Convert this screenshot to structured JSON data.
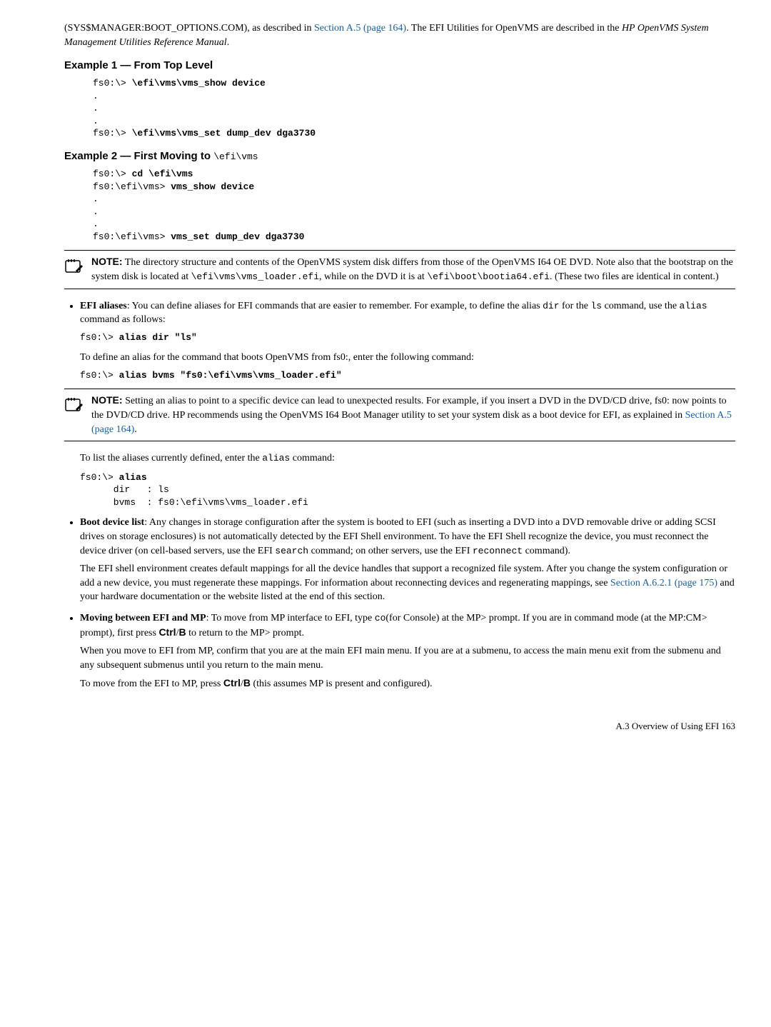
{
  "intro": {
    "text1": "(SYS$MANAGER:BOOT_OPTIONS.COM), as described in ",
    "link": "Section A.5 (page 164)",
    "text2": ". The EFI Utilities for OpenVMS are described in the ",
    "italic": "HP OpenVMS System Management Utilities Reference Manual",
    "text3": "."
  },
  "example1": {
    "heading": "Example 1 — From Top Level",
    "code": "fs0:\\> \\efi\\vms\\vms_show device\n.\n.\n.\nfs0:\\> \\efi\\vms\\vms_set dump_dev dga3730",
    "code_plain_lines": [
      "fs0:\\> ",
      ".",
      ".",
      ".",
      "fs0:\\> "
    ],
    "code_bold_parts": [
      "\\efi\\vms\\vms_show device",
      "\\efi\\vms\\vms_set dump_dev dga3730"
    ]
  },
  "example2": {
    "heading_prefix": "Example 2 — First Moving to ",
    "heading_code": "\\efi\\vms",
    "line1_plain": "fs0:\\> ",
    "line1_bold": "cd \\efi\\vms",
    "line2_plain": "fs0:\\efi\\vms> ",
    "line2_bold": "vms_show device",
    "dots": ".",
    "line3_plain": "fs0:\\efi\\vms> ",
    "line3_bold": "vms_set dump_dev dga3730"
  },
  "note1": {
    "label": "NOTE:",
    "t1": "    The directory structure and contents of the OpenVMS system disk differs from those of the OpenVMS I64 OE DVD. Note also that the bootstrap on the system disk is located at ",
    "c1": "\\efi\\vms\\vms_loader.efi",
    "t2": ", while on the DVD it is at ",
    "c2": "\\efi\\boot\\bootia64.efi",
    "t3": ". (These two files are identical in content.)"
  },
  "bullet_efi_aliases": {
    "b1": "EFI aliases",
    "t1": ": You can define aliases for EFI commands that are easier to remember. For example, to define the alias ",
    "c1": "dir",
    "t2": " for the ",
    "c2": "ls",
    "t3": " command, use the ",
    "c3": "alias",
    "t4": " command as follows:",
    "code1_plain": "fs0:\\> ",
    "code1_bold": "alias dir \"ls\"",
    "p2": "To define an alias for the command that boots OpenVMS from fs0:, enter the following command:",
    "code2_plain": "fs0:\\> ",
    "code2_bold": "alias bvms \"fs0:\\efi\\vms\\vms_loader.efi\""
  },
  "note2": {
    "label": "NOTE:",
    "t1": "    Setting an alias to point to a specific device can lead to unexpected results. For example, if you insert a DVD in the DVD/CD drive, fs0: now points to the DVD/CD drive. HP recommends using the OpenVMS I64 Boot Manager utility to set your system disk as a boot device for EFI, as explained in ",
    "link": "Section A.5 (page 164)",
    "t2": "."
  },
  "alias_list": {
    "intro_t1": "To list the aliases currently defined, enter the ",
    "intro_c1": "alias",
    "intro_t2": " command:",
    "line1_plain": "fs0:\\> ",
    "line1_bold": "alias",
    "line2": "      dir   : ls",
    "line3": "      bvms  : fs0:\\efi\\vms\\vms_loader.efi"
  },
  "bullet_boot_device": {
    "b1": "Boot device list",
    "t1": ": Any changes in storage configuration after the system is booted to EFI (such as inserting a DVD into a DVD removable drive or adding SCSI drives on storage enclosures) is not automatically detected by the EFI Shell environment. To have the EFI Shell recognize the device, you must reconnect the device driver (on cell-based servers, use the EFI ",
    "c1": "search",
    "t2": " command; on other servers, use the EFI ",
    "c2": "reconnect",
    "t3": " command).",
    "p2_t1": "The EFI shell environment creates default mappings for all the device handles that support a recognized file system. After you change the system configuration or add a new device, you must regenerate these mappings. For information about reconnecting devices and regenerating mappings, see ",
    "p2_link": "Section A.6.2.1 (page 175)",
    "p2_t2": " and your hardware documentation or the website listed at the end of this section."
  },
  "bullet_moving": {
    "b1": "Moving between EFI and MP",
    "t1": ": To move from MP interface to EFI, type ",
    "c1": "co",
    "t2": "(for Console) at the MP> prompt. If you are in command mode (at the MP:CM> prompt), first press ",
    "k1": "Ctrl",
    "t3": "/",
    "k2": "B",
    "t4": " to return to the MP> prompt.",
    "p2": "When you move to EFI from MP, confirm that you are at the main EFI main menu. If you are at a submenu, to access the main menu exit from the submenu and any subsequent submenus until you return to the main menu.",
    "p3_t1": "To move from the EFI to MP, press ",
    "p3_k1": "Ctrl",
    "p3_t2": "/",
    "p3_k2": "B",
    "p3_t3": " (this assumes MP is present and configured)."
  },
  "footer": "A.3 Overview of Using EFI    163"
}
